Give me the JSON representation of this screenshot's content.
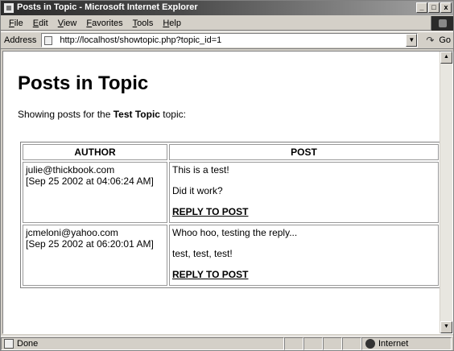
{
  "window": {
    "title": "Posts in Topic - Microsoft Internet Explorer",
    "controls": {
      "minimize": "_",
      "maximize": "□",
      "close": "x"
    }
  },
  "menu": [
    "File",
    "Edit",
    "View",
    "Favorites",
    "Tools",
    "Help"
  ],
  "address": {
    "label": "Address",
    "url": "http://localhost/showtopic.php?topic_id=1",
    "go_label": "Go"
  },
  "page": {
    "heading": "Posts in Topic",
    "intro_prefix": "Showing posts for the ",
    "topic_name": "Test Topic",
    "intro_suffix": " topic:",
    "table": {
      "headers": [
        "AUTHOR",
        "POST"
      ],
      "rows": [
        {
          "author": "julie@thickbook.com",
          "date": "[Sep 25 2002 at 04:06:24 AM]",
          "lines": [
            "This is a test!",
            "Did it work?"
          ],
          "reply": "REPLY TO POST"
        },
        {
          "author": "jcmeloni@yahoo.com",
          "date": "[Sep 25 2002 at 06:20:01 AM]",
          "lines": [
            "Whoo hoo, testing the reply...",
            "test, test, test!"
          ],
          "reply": "REPLY TO POST"
        }
      ]
    }
  },
  "status": {
    "text": "Done",
    "zone": "Internet"
  }
}
